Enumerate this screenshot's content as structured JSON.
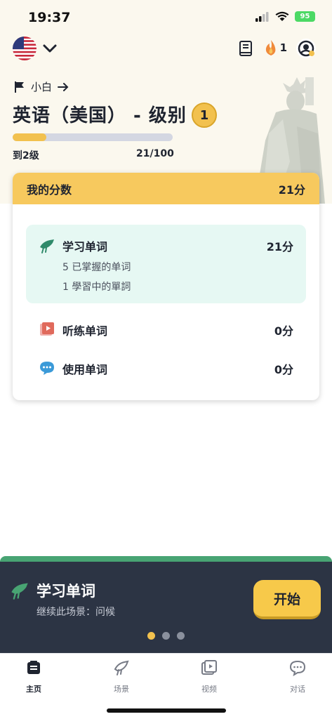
{
  "status_bar": {
    "time": "19:37",
    "battery": "95"
  },
  "top_nav": {
    "streak_count": "1"
  },
  "level": {
    "breadcrumb_name": "小白",
    "title": "英语（美国） - 级别",
    "level_number": "1",
    "progress_fraction": 0.21,
    "next_level_label": "到2级",
    "progress_text": "21/100"
  },
  "score_card": {
    "header_title": "我的分数",
    "header_score": "21分",
    "learn": {
      "title": "学习单词",
      "score": "21分",
      "mastered": "5 已掌握的单词",
      "learning": "1 學習中的單詞"
    },
    "listen": {
      "title": "听练单词",
      "score": "0分"
    },
    "use": {
      "title": "使用单词",
      "score": "0分"
    }
  },
  "bottom_panel": {
    "title": "学习单词",
    "subtitle": "继续此场景：问候",
    "start_label": "开始",
    "active_dot": 0,
    "dot_count": 3
  },
  "tabs": [
    {
      "label": "主页",
      "icon": "home-icon",
      "active": true
    },
    {
      "label": "场景",
      "icon": "scenes-icon",
      "active": false
    },
    {
      "label": "视频",
      "icon": "video-icon",
      "active": false
    },
    {
      "label": "对话",
      "icon": "chat-icon",
      "active": false
    }
  ],
  "colors": {
    "accent_yellow": "#f7c95e",
    "accent_green": "#48a473",
    "dark_panel": "#2c3444",
    "learn_bg": "#e6f8f3"
  }
}
